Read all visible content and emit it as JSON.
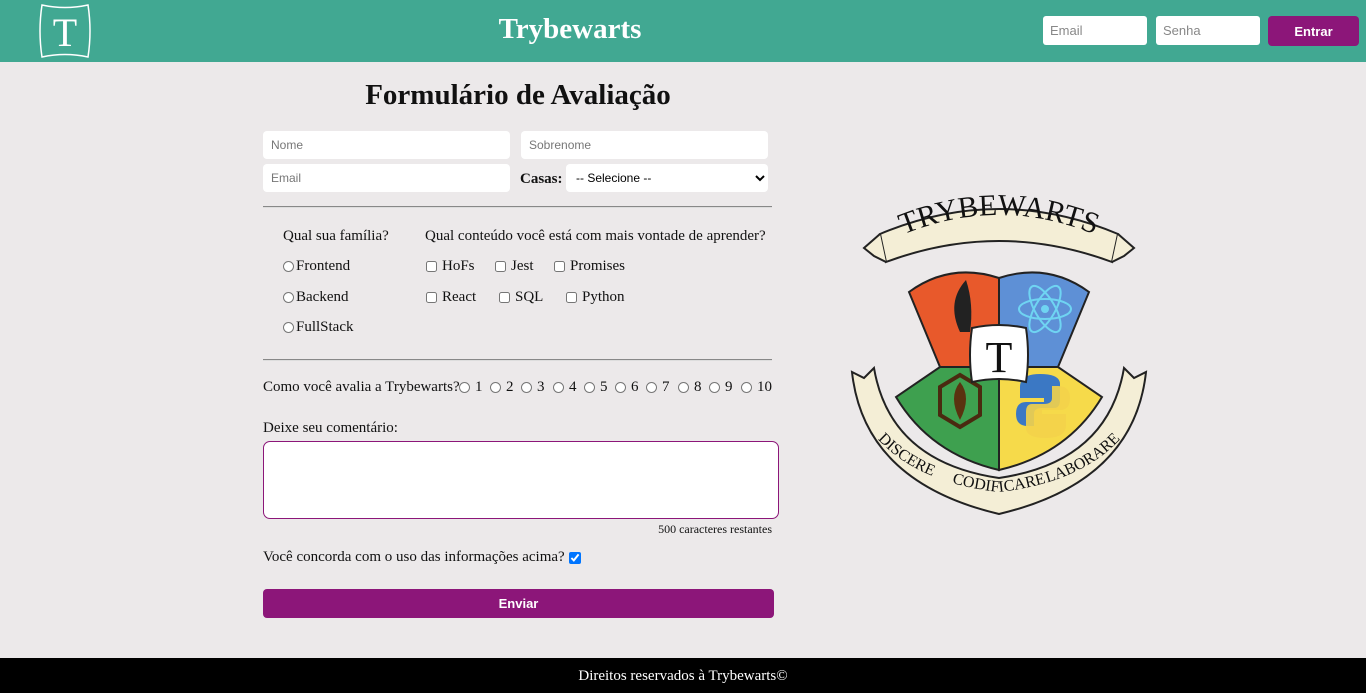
{
  "header": {
    "logo_letter": "T",
    "title": "Trybewarts",
    "email_placeholder": "Email",
    "password_placeholder": "Senha",
    "login_label": "Entrar"
  },
  "form": {
    "title": "Formulário de Avaliação",
    "name_placeholder": "Nome",
    "lastname_placeholder": "Sobrenome",
    "email_placeholder": "Email",
    "house_label": "Casas:",
    "house_selected": "-- Selecione --",
    "family_question": "Qual sua família?",
    "families": [
      "Frontend",
      "Backend",
      "FullStack"
    ],
    "content_question": "Qual conteúdo você está com mais vontade de aprender?",
    "contents": [
      "HoFs",
      "Jest",
      "Promises",
      "React",
      "SQL",
      "Python"
    ],
    "rate_question": "Como você avalia a Trybewarts?",
    "rates": [
      "1",
      "2",
      "3",
      "4",
      "5",
      "6",
      "7",
      "8",
      "9",
      "10"
    ],
    "comment_label": "Deixe seu comentário:",
    "counter": "500 caracteres restantes",
    "agreement": "Você concorda com o uso das informações acima?",
    "submit_label": "Enviar"
  },
  "crest": {
    "banner_top": "TRYBEWARTS",
    "motto_left": "DISCERE",
    "motto_center": "CODIFICARE",
    "motto_right": "LABORARE",
    "shield_letter": "T"
  },
  "footer": {
    "text": "Direitos reservados à Trybewarts©"
  },
  "colors": {
    "header_bg": "#41a892",
    "accent": "#8c1679",
    "page_bg": "#ece9ea",
    "footer_bg": "#000000"
  }
}
